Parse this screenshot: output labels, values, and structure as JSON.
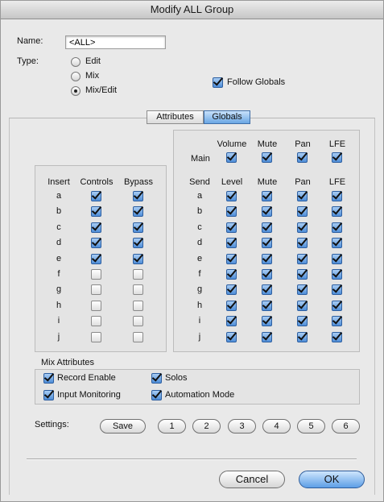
{
  "window": {
    "title": "Modify ALL Group"
  },
  "name_field": {
    "label": "Name:",
    "value": "<ALL>"
  },
  "type": {
    "label": "Type:",
    "options": [
      {
        "label": "Edit",
        "selected": false
      },
      {
        "label": "Mix",
        "selected": false
      },
      {
        "label": "Mix/Edit",
        "selected": true
      }
    ]
  },
  "follow_globals": {
    "label": "Follow Globals",
    "checked": true
  },
  "tabs": [
    {
      "label": "Attributes",
      "selected": false
    },
    {
      "label": "Globals",
      "selected": true
    }
  ],
  "insert_panel": {
    "headers": [
      "Insert",
      "Controls",
      "Bypass"
    ],
    "rows": [
      {
        "label": "a",
        "controls": true,
        "bypass": true
      },
      {
        "label": "b",
        "controls": true,
        "bypass": true
      },
      {
        "label": "c",
        "controls": true,
        "bypass": true
      },
      {
        "label": "d",
        "controls": true,
        "bypass": true
      },
      {
        "label": "e",
        "controls": true,
        "bypass": true
      },
      {
        "label": "f",
        "controls": false,
        "bypass": false
      },
      {
        "label": "g",
        "controls": false,
        "bypass": false
      },
      {
        "label": "h",
        "controls": false,
        "bypass": false
      },
      {
        "label": "i",
        "controls": false,
        "bypass": false
      },
      {
        "label": "j",
        "controls": false,
        "bypass": false
      }
    ]
  },
  "main_panel": {
    "headers": [
      "Volume",
      "Mute",
      "Pan",
      "LFE"
    ],
    "row_label": "Main",
    "values": [
      true,
      true,
      true,
      true
    ]
  },
  "send_panel": {
    "headers": [
      "Send",
      "Level",
      "Mute",
      "Pan",
      "LFE"
    ],
    "rows": [
      {
        "label": "a",
        "values": [
          true,
          true,
          true,
          true
        ]
      },
      {
        "label": "b",
        "values": [
          true,
          true,
          true,
          true
        ]
      },
      {
        "label": "c",
        "values": [
          true,
          true,
          true,
          true
        ]
      },
      {
        "label": "d",
        "values": [
          true,
          true,
          true,
          true
        ]
      },
      {
        "label": "e",
        "values": [
          true,
          true,
          true,
          true
        ]
      },
      {
        "label": "f",
        "values": [
          true,
          true,
          true,
          true
        ]
      },
      {
        "label": "g",
        "values": [
          true,
          true,
          true,
          true
        ]
      },
      {
        "label": "h",
        "values": [
          true,
          true,
          true,
          true
        ]
      },
      {
        "label": "i",
        "values": [
          true,
          true,
          true,
          true
        ]
      },
      {
        "label": "j",
        "values": [
          true,
          true,
          true,
          true
        ]
      }
    ]
  },
  "mix_attributes": {
    "title": "Mix Attributes",
    "items": [
      {
        "label": "Record Enable",
        "checked": true
      },
      {
        "label": "Solos",
        "checked": true
      },
      {
        "label": "Input Monitoring",
        "checked": true
      },
      {
        "label": "Automation Mode",
        "checked": true
      }
    ]
  },
  "settings": {
    "label": "Settings:",
    "save_label": "Save",
    "slots": [
      "1",
      "2",
      "3",
      "4",
      "5",
      "6"
    ]
  },
  "buttons": {
    "cancel": "Cancel",
    "ok": "OK"
  }
}
